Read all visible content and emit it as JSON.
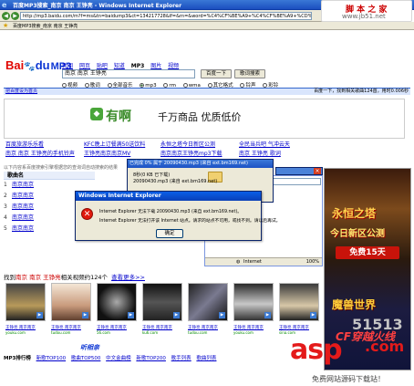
{
  "window": {
    "title": "百度MP3搜索_南京 南京 王铮亮 - Windows Internet Explorer",
    "address": "http://mp3.baidu.com/m?f=ms&tn=baidump3&ct=134217728&lf=&rn=&word=%C4%CF%BE%A9+%C4%CF%BE%A9+%CD%F5%EF",
    "favorite": "百度MP3搜索_南京 南京 王铮亮"
  },
  "site_badge": {
    "name": "脚 本 之 家",
    "url": "www.jb51.net"
  },
  "search": {
    "tabs": [
      "新闻",
      "网页",
      "贴吧",
      "知道",
      "MP3",
      "图片",
      "视频"
    ],
    "active_tab": "MP3",
    "query": "南京 南京 王铮亮",
    "btn_search": "百度一下",
    "btn_lyrics": "歌词搜索",
    "help": "帮助",
    "formats": [
      "视频",
      "歌词",
      "全部音乐",
      "mp3",
      "rm",
      "wma",
      "其它格式",
      "铃声",
      "彩铃"
    ],
    "selected_format": "mp3"
  },
  "result_bar": {
    "left": "把百度设为首页",
    "right": "百度一下，找到相关歌曲124首，用时0.006秒"
  },
  "ad": {
    "brand": "有啊",
    "slogan": "千万商品 优质低价"
  },
  "links": {
    "row1": [
      "百度旅游乐乐看",
      "KFC晚上订餐满50送饮料",
      "永恒之塔今日新区公测",
      "全民当兵吧 气冲云天"
    ],
    "row2": [
      "南京 南京 王铮亮的手机铃声",
      "王铮亮南京南京MV",
      "南京南京王铮亮mp3下载",
      "南京 王铮亮 歌词"
    ]
  },
  "hint": "以下内容系百度搜索引擎根据您的查询词自动搜索的结果",
  "songs": {
    "header": "歌曲名",
    "rows": [
      {
        "num": "1",
        "title": "南京南京"
      },
      {
        "num": "2",
        "title": "南京南京"
      },
      {
        "num": "3",
        "title": "南京南京"
      },
      {
        "num": "4",
        "title": "南京南京"
      },
      {
        "num": "5",
        "title": "南京南京"
      }
    ]
  },
  "sidebar_ad": {
    "game1": "永恒之塔",
    "game2": "今日新区公测",
    "free": "免费15天",
    "game3": "魔兽世界",
    "game4": "CF穿越火线"
  },
  "videos": {
    "lead": "找到",
    "keyword": "南京 南京 王铮亮",
    "tail": "相关视频约124个",
    "more": "查看更多>>",
    "items": [
      {
        "caption": "王铮亮 南京南京",
        "source": "youku.com"
      },
      {
        "caption": "王铮亮 南京南京",
        "source": "tudou.com"
      },
      {
        "caption": "王铮亮 南京南京",
        "source": "56.com"
      },
      {
        "caption": "王铮亮 南京南京",
        "source": "ku6.com"
      },
      {
        "caption": "王铮亮 南京南京",
        "source": "tudou.com"
      },
      {
        "caption": "王铮亮 南京南京",
        "source": "youku.com"
      },
      {
        "caption": "王铮亮 南京南京",
        "source": "sina.com"
      }
    ]
  },
  "bottom_brand": "听相亲",
  "chart_links": {
    "head": "MP3排行榜",
    "items": [
      "新歌TOP100",
      "歌曲TOP500",
      "中文金曲榜",
      "新歌TOP200",
      "歌手列表",
      "歌曲列表"
    ]
  },
  "download_dialog": {
    "title": "已完成 0% 属于 20090430.mp3 (来自 ext.bm169.net)",
    "line1": "8秒(0 KB 已下载)",
    "line2": "20090430.mp3 (来自 ext.bm169.net)"
  },
  "bg_window": {
    "address": "http://ext.bm169.net",
    "status": "Internet",
    "zoom": "100%"
  },
  "error_dialog": {
    "title": "Windows Internet Explorer",
    "line1": "Internet Explorer 无法下载 20090430.mp3 (来自 ext.bm169.net)。",
    "line2": "Internet Explorer 无法打开该 Internet 站点。请求的站点不可用，或找不到。请以后再试。",
    "ok": "确定"
  },
  "watermark": {
    "asp": "asp",
    "num": "51513",
    "com": ".com",
    "sub": "免费网站源码下载站！"
  }
}
